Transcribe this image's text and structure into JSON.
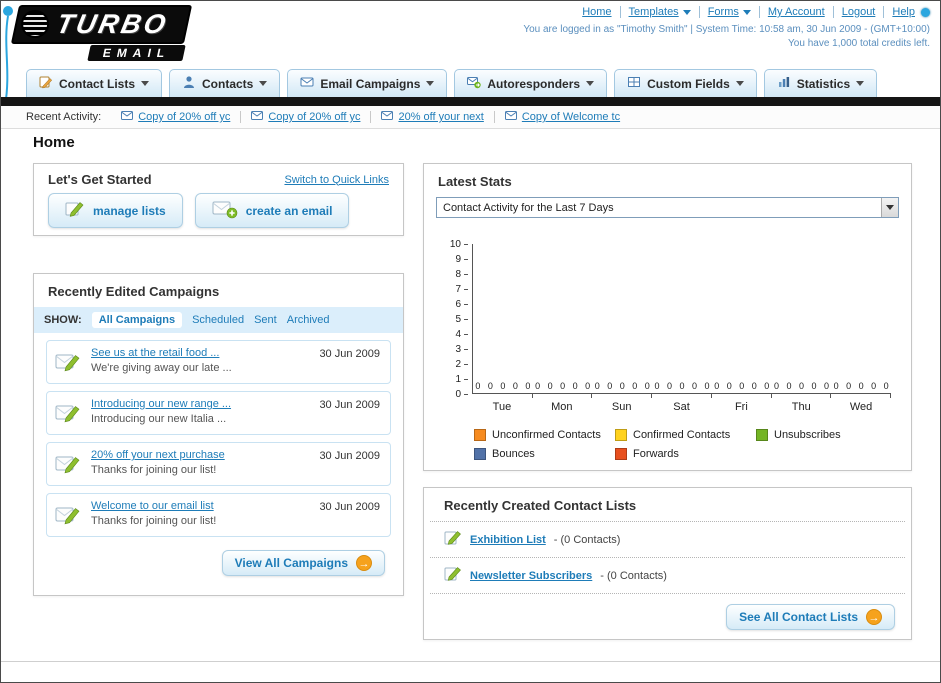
{
  "header": {
    "logo": {
      "title": "TURBO",
      "subtitle": "EMAIL"
    },
    "top_links": [
      "Home",
      "Templates",
      "Forms",
      "My Account",
      "Logout",
      "Help"
    ],
    "login_line": "You are logged in as \"Timothy Smith\" | System Time: 10:58 am, 30 Jun 2009 - (GMT+10:00)",
    "credits_line": "You have 1,000 total credits left."
  },
  "nav": {
    "tabs": [
      {
        "label": "Contact Lists",
        "icon": "contact-lists-icon"
      },
      {
        "label": "Contacts",
        "icon": "contacts-icon"
      },
      {
        "label": "Email Campaigns",
        "icon": "email-campaigns-icon"
      },
      {
        "label": "Autoresponders",
        "icon": "autoresponders-icon"
      },
      {
        "label": "Custom Fields",
        "icon": "custom-fields-icon"
      },
      {
        "label": "Statistics",
        "icon": "statistics-icon"
      }
    ]
  },
  "recent_activity": {
    "label": "Recent Activity:",
    "items": [
      "Copy of 20% off yc",
      "Copy of 20% off yc",
      "20% off your next",
      "Copy of Welcome tc"
    ]
  },
  "page": {
    "title": "Home"
  },
  "get_started": {
    "title": "Let's Get Started",
    "switch_link": "Switch to Quick Links",
    "manage_lists_label": "manage lists",
    "create_email_label": "create an email"
  },
  "campaigns": {
    "title": "Recently Edited Campaigns",
    "show_label": "SHOW:",
    "filters": [
      "All Campaigns",
      "Scheduled",
      "Sent",
      "Archived"
    ],
    "items": [
      {
        "title": "See us at the retail food ...",
        "subtitle": "We're giving away our late ...",
        "date": "30 Jun 2009"
      },
      {
        "title": "Introducing our new range ...",
        "subtitle": "Introducing our new Italia ...",
        "date": "30 Jun 2009"
      },
      {
        "title": "20% off your next purchase",
        "subtitle": "Thanks for joining our list!",
        "date": "30 Jun 2009"
      },
      {
        "title": "Welcome to our email list",
        "subtitle": "Thanks for joining our list!",
        "date": "30 Jun 2009"
      }
    ],
    "view_all_label": "View All Campaigns"
  },
  "stats": {
    "title": "Latest Stats",
    "dropdown_value": "Contact Activity for the Last 7 Days",
    "chart_data": {
      "type": "bar",
      "title": "Contact Activity for the Last 7 Days",
      "categories": [
        "Tue",
        "Mon",
        "Sun",
        "Sat",
        "Fri",
        "Thu",
        "Wed"
      ],
      "series": [
        {
          "name": "Unconfirmed Contacts",
          "color": "#f68b1f",
          "values": [
            0,
            0,
            0,
            0,
            0,
            0,
            0
          ]
        },
        {
          "name": "Confirmed Contacts",
          "color": "#ffd21e",
          "values": [
            0,
            0,
            0,
            0,
            0,
            0,
            0
          ]
        },
        {
          "name": "Unsubscribes",
          "color": "#74b524",
          "values": [
            0,
            0,
            0,
            0,
            0,
            0,
            0
          ]
        },
        {
          "name": "Bounces",
          "color": "#5272a8",
          "values": [
            0,
            0,
            0,
            0,
            0,
            0,
            0
          ]
        },
        {
          "name": "Forwards",
          "color": "#e8501f",
          "values": [
            0,
            0,
            0,
            0,
            0,
            0,
            0
          ]
        }
      ],
      "ylim": [
        0,
        10
      ],
      "y_step": 1,
      "grid": false,
      "legend_position": "bottom"
    }
  },
  "contact_lists": {
    "title": "Recently Created Contact Lists",
    "items": [
      {
        "name": "Exhibition List",
        "detail": "- (0 Contacts)"
      },
      {
        "name": "Newsletter Subscribers",
        "detail": "- (0 Contacts)"
      }
    ],
    "see_all_label": "See All Contact Lists"
  }
}
